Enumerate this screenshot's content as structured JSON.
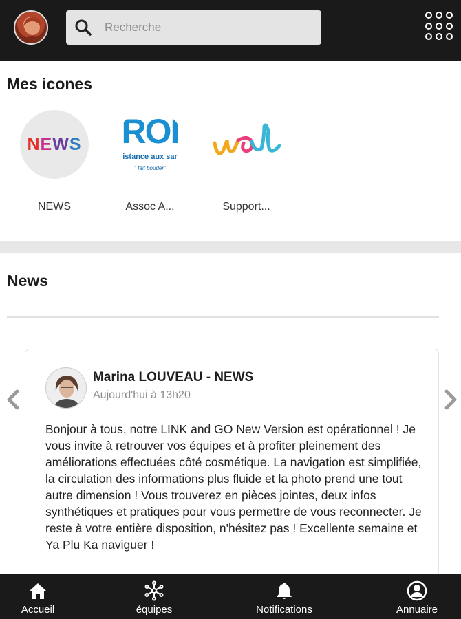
{
  "header": {
    "search": {
      "placeholder": "Recherche",
      "value": ""
    },
    "icons": {
      "avatar": "user-avatar",
      "search": "search-icon",
      "apps": "apps-grid-icon"
    }
  },
  "mes_icones": {
    "title": "Mes icones",
    "items": [
      {
        "label": "NEWS",
        "logo_letters": [
          "N",
          "E",
          "W",
          "S"
        ],
        "icon": "news-logo-icon"
      },
      {
        "label": "Assoc A...",
        "logo_text": "ROI",
        "logo_sub": "istance aux sar",
        "logo_sub2": "\" fait bouder\"",
        "icon": "assoc-logo-icon"
      },
      {
        "label": "Support...",
        "logo_text": "wal",
        "icon": "wal-logo-icon"
      }
    ]
  },
  "news": {
    "title": "News",
    "post": {
      "author": "Marina LOUVEAU - NEWS",
      "time": "Aujourd'hui à 13h20",
      "body": "Bonjour à tous, notre LINK and GO New Version est opérationnel ! Je vous invite à retrouver vos équipes et à profiter pleinement des améliorations effectuées côté cosmétique. La navigation est simplifiée, la circulation des informations plus fluide et la photo prend une tout autre dimension ! Vous trouverez en pièces jointes, deux infos synthétiques et pratiques pour vous permettre de vous reconnecter. Je reste à votre entière disposition, n'hésitez pas ! Excellente semaine et Ya Plu Ka naviguer !"
    },
    "arrows": {
      "prev": "chevron-left-icon",
      "next": "chevron-right-icon"
    }
  },
  "bottom_nav": {
    "items": [
      {
        "label": "Accueil",
        "icon": "home-icon"
      },
      {
        "label": "équipes",
        "icon": "network-icon"
      },
      {
        "label": "Notifications",
        "icon": "bell-icon"
      },
      {
        "label": "Annuaire",
        "icon": "user-circle-icon"
      }
    ]
  },
  "colors": {
    "topbar": "#1a1a1a",
    "bottombar": "#1a1a1a",
    "search_bg": "#e4e4e4",
    "separator": "#e7e7e7"
  }
}
